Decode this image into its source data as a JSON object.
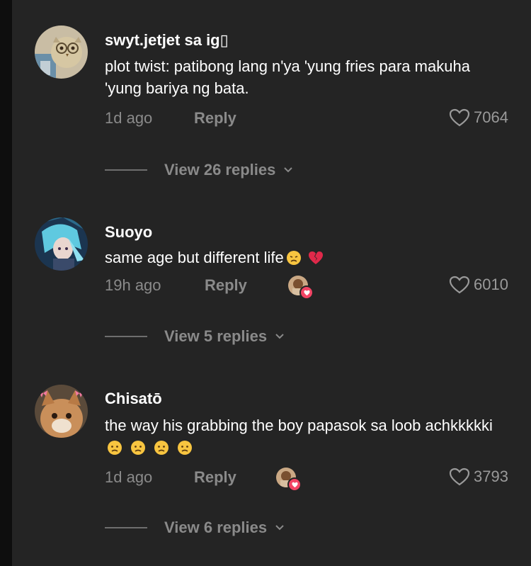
{
  "comments": [
    {
      "username": "swyt.jetjet sa ig▯",
      "text": "plot twist: patibong lang n'ya 'yung fries para makuha 'yung bariya ng bata.",
      "time": "1d ago",
      "reply_label": "Reply",
      "likes": "7064",
      "view_replies": "View 26 replies",
      "avatar_icon": "owl-avatar"
    },
    {
      "username": "Suoyo",
      "text": "same age but different life",
      "emojis": [
        "disappointed-face-emoji",
        "broken-heart-emoji"
      ],
      "time": "19h ago",
      "reply_label": "Reply",
      "likes": "6010",
      "view_replies": "View 5 replies",
      "creator_liked": true,
      "avatar_icon": "anime-character-avatar"
    },
    {
      "username": "Chisatō",
      "text": "the way his grabbing the boy papasok sa loob achkkkkki",
      "emojis": [
        "worried-face-emoji",
        "worried-face-emoji",
        "worried-face-emoji",
        "worried-face-emoji"
      ],
      "time": "1d ago",
      "reply_label": "Reply",
      "likes": "3793",
      "view_replies": "View 6 replies",
      "creator_liked": true,
      "avatar_icon": "cat-avatar"
    }
  ],
  "colors": {
    "background": "#242424",
    "text": "#ffffff",
    "muted": "#8a8a8a",
    "badge": "#f24464"
  }
}
